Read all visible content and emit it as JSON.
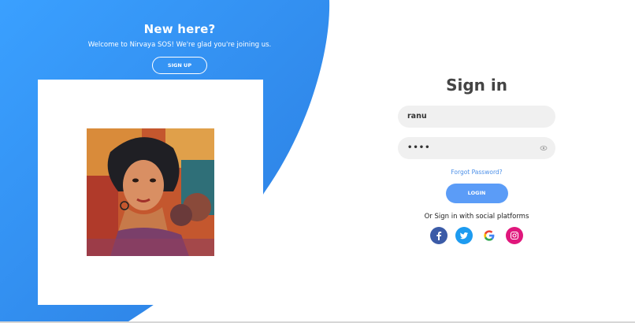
{
  "left": {
    "title": "New here?",
    "subtitle": "Welcome to Nirvaya SOS! We're glad you're joining us.",
    "signup_label": "SIGN UP"
  },
  "signin": {
    "title": "Sign in",
    "username_value": "ranu",
    "password_value": "••••",
    "forgot_label": "Forgot Password?",
    "login_label": "LOGIN",
    "social_text": "Or Sign in with social platforms",
    "social_icons": [
      "facebook-icon",
      "twitter-icon",
      "google-icon",
      "instagram-icon"
    ]
  },
  "colors": {
    "accent": "#2e8cf5",
    "login_button": "#5b9cf7",
    "link": "#4b8fe8"
  }
}
